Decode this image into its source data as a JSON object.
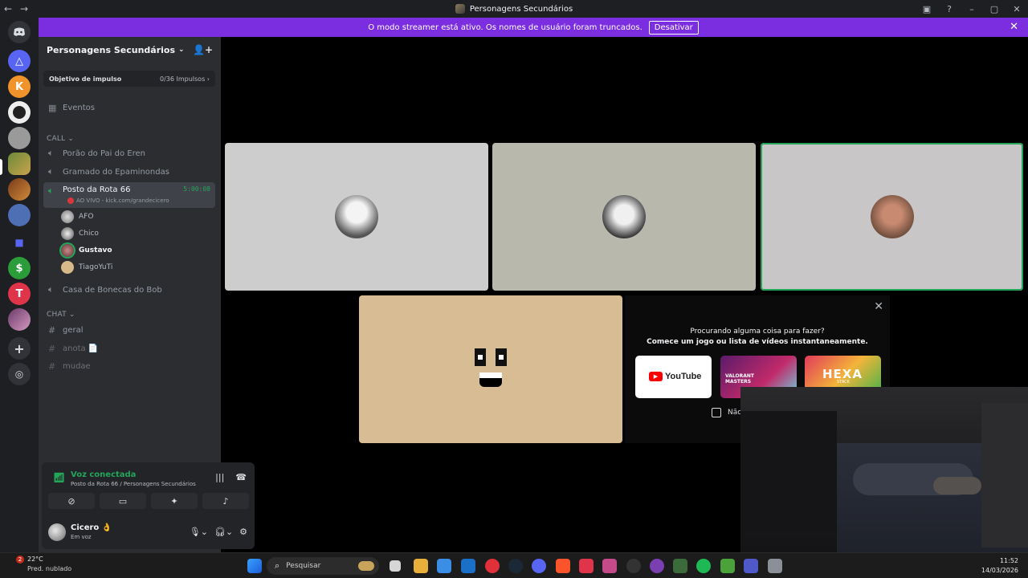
{
  "window": {
    "title": "Personagens Secundários"
  },
  "banner": {
    "text": "O modo streamer está ativo. Os nomes de usuário foram truncados.",
    "button": "Desativar"
  },
  "server": {
    "name": "Personagens Secundários",
    "boost_label": "Objetivo de impulso",
    "boost_value": "0/36 Impulsos"
  },
  "events_label": "Eventos",
  "categories": {
    "call": "CALL",
    "chat": "CHAT"
  },
  "voice_channels": {
    "c1": "Porão do Pai do Eren",
    "c2": "Gramado do Epaminondas",
    "c3": "Posto da Rota 66",
    "c3_timer": "5:00:08",
    "c3_live": "AO VIVO - kick.com/grandecicero",
    "c4": "Casa de Bonecas do Bob"
  },
  "members": {
    "m1": "AFO",
    "m2": "Chico",
    "m3": "Gustavo",
    "m4": "TiagoYuTi"
  },
  "text_channels": {
    "t1": "geral",
    "t2": "anota 📄",
    "t3": "mudae"
  },
  "voice_panel": {
    "status": "Voz conectada",
    "location": "Posto da Rota 66 / Personagens Secundários"
  },
  "user": {
    "name": "Cicero 👌",
    "status": "Em voz"
  },
  "activity": {
    "line1": "Procurando alguma coisa para fazer?",
    "line2": "Comece um jogo ou lista de vídeos instantaneamente.",
    "card1": "YouTube",
    "card2": "VALORANT MASTERS",
    "card3": "HEXA",
    "card3_sub": "STACK",
    "checkbox": "Não"
  },
  "taskbar": {
    "weather_temp": "22°C",
    "weather_desc": "Pred. nublado",
    "weather_badge": "2",
    "search_placeholder": "Pesquisar",
    "time": "11:52",
    "date": "14/03/2026"
  },
  "colors": {
    "accent_green": "#23a55a",
    "banner": "#7b2ee0",
    "sidebar": "#2b2d31",
    "rail": "#1e1f22"
  }
}
